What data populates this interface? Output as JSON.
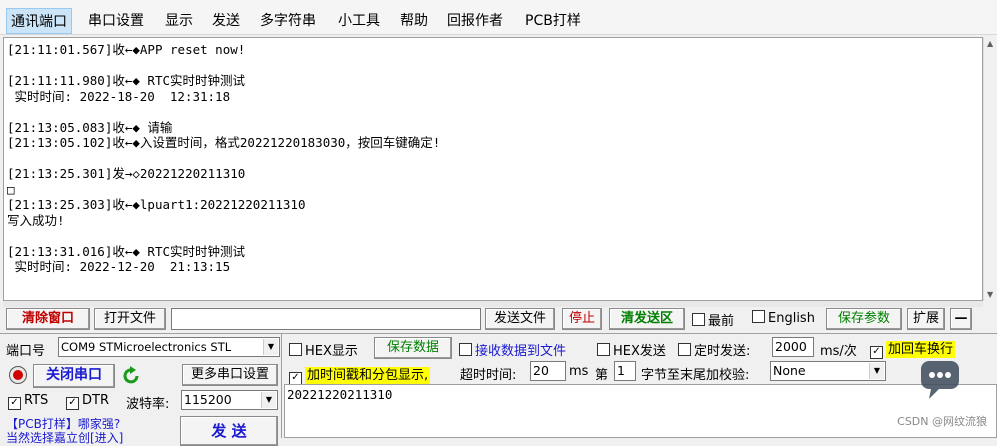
{
  "menu": [
    "通讯端口",
    "串口设置",
    "显示",
    "发送",
    "多字符串",
    "小工具",
    "帮助",
    "回报作者",
    "PCB打样"
  ],
  "terminal_lines": [
    "[21:11:01.567]收←◆APP reset now!",
    "",
    "[21:11:11.980]收←◆ RTC实时时钟测试",
    " 实时时间: 2022-18-20  12:31:18",
    "",
    "[21:13:05.083]收←◆ 请输",
    "[21:13:05.102]收←◆入设置时间，格式20221220183030，按回车键确定!",
    "",
    "[21:13:25.301]发→◇20221220211310",
    "□",
    "[21:13:25.303]收←◆lpuart1:20221220211310",
    "写入成功!",
    "",
    "[21:13:31.016]收←◆ RTC实时时钟测试",
    " 实时时间: 2022-12-20  21:13:15"
  ],
  "toolbar": {
    "clear_window": "清除窗口",
    "open_file": "打开文件",
    "file_path": "",
    "send_file": "发送文件",
    "stop": "停止",
    "clear_send": "清发送区",
    "topmost": "最前",
    "english": "English",
    "save_params": "保存参数",
    "expand": "扩展",
    "collapse": "—"
  },
  "port": {
    "port_label": "端口号",
    "port_value": "COM9 STMicroelectronics STL",
    "close_port": "关闭串口",
    "refresh_icon": "↻",
    "more_settings": "更多串口设置",
    "rts": "RTS",
    "dtr": "DTR",
    "baud_label": "波特率:",
    "baud_value": "115200"
  },
  "recv_options": {
    "hex_display": "HEX显示",
    "save_data": "保存数据",
    "recv_to_file": "接收数据到文件",
    "timestamp": "加时间戳和分包显示,",
    "timeout_label": "超时时间:",
    "timeout_value": "20",
    "timeout_unit": "ms",
    "byte_label": "第",
    "byte_value": "1",
    "byte_desc": "字节至末尾加校验:",
    "checksum_value": "None"
  },
  "send_options": {
    "hex_send": "HEX发送",
    "timed_send": "定时发送:",
    "interval_value": "2000",
    "interval_unit": "ms/次",
    "add_crlf": "加回车换行"
  },
  "send_text": "20221220211310",
  "ad": {
    "line1": "【PCB打样】哪家强?",
    "line2": "当然选择嘉立创[进入]"
  },
  "send_button": "发 送",
  "watermark": "CSDN @网纹流狼",
  "icons": {
    "refresh": "refresh-icon",
    "power": "power-icon",
    "chat": "chat-bubble-icon"
  },
  "colors": {
    "highlight_yellow": "#ffff00",
    "green_text": "#008000",
    "red_text": "#c00000",
    "blue_text": "#1a1ad0"
  }
}
